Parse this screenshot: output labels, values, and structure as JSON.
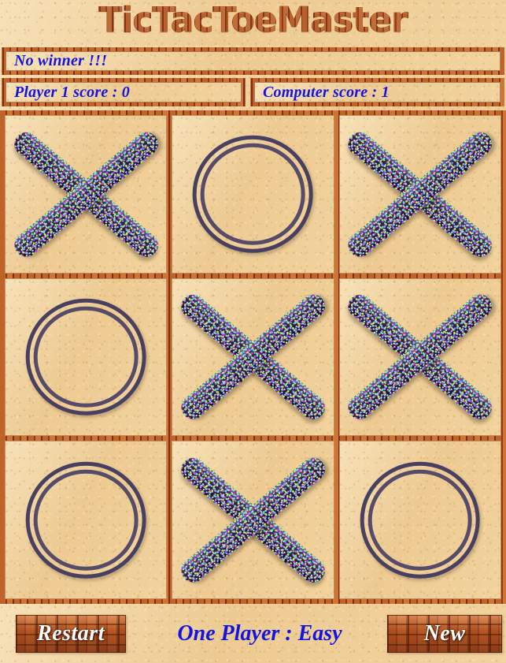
{
  "app": {
    "title": "TicTacToeMaster"
  },
  "status": {
    "message": "No winner !!!"
  },
  "scores": {
    "player1_label": "Player 1 score : 0",
    "computer_label": "Computer score : 1"
  },
  "board": {
    "cells": [
      {
        "id": "cell-0",
        "mark": "X"
      },
      {
        "id": "cell-1",
        "mark": "O"
      },
      {
        "id": "cell-2",
        "mark": "X"
      },
      {
        "id": "cell-3",
        "mark": "O"
      },
      {
        "id": "cell-4",
        "mark": "X"
      },
      {
        "id": "cell-5",
        "mark": "X"
      },
      {
        "id": "cell-6",
        "mark": "O"
      },
      {
        "id": "cell-7",
        "mark": "X"
      },
      {
        "id": "cell-8",
        "mark": "O"
      }
    ]
  },
  "controls": {
    "restart_label": "Restart",
    "mode_label": "One Player : Easy",
    "new_label": "New"
  },
  "colors": {
    "text_blue": "#1414e0",
    "brick_red": "#a8491e",
    "sand": "#edcb93",
    "ring_purple": "#474061",
    "button_text": "#ffffff"
  }
}
